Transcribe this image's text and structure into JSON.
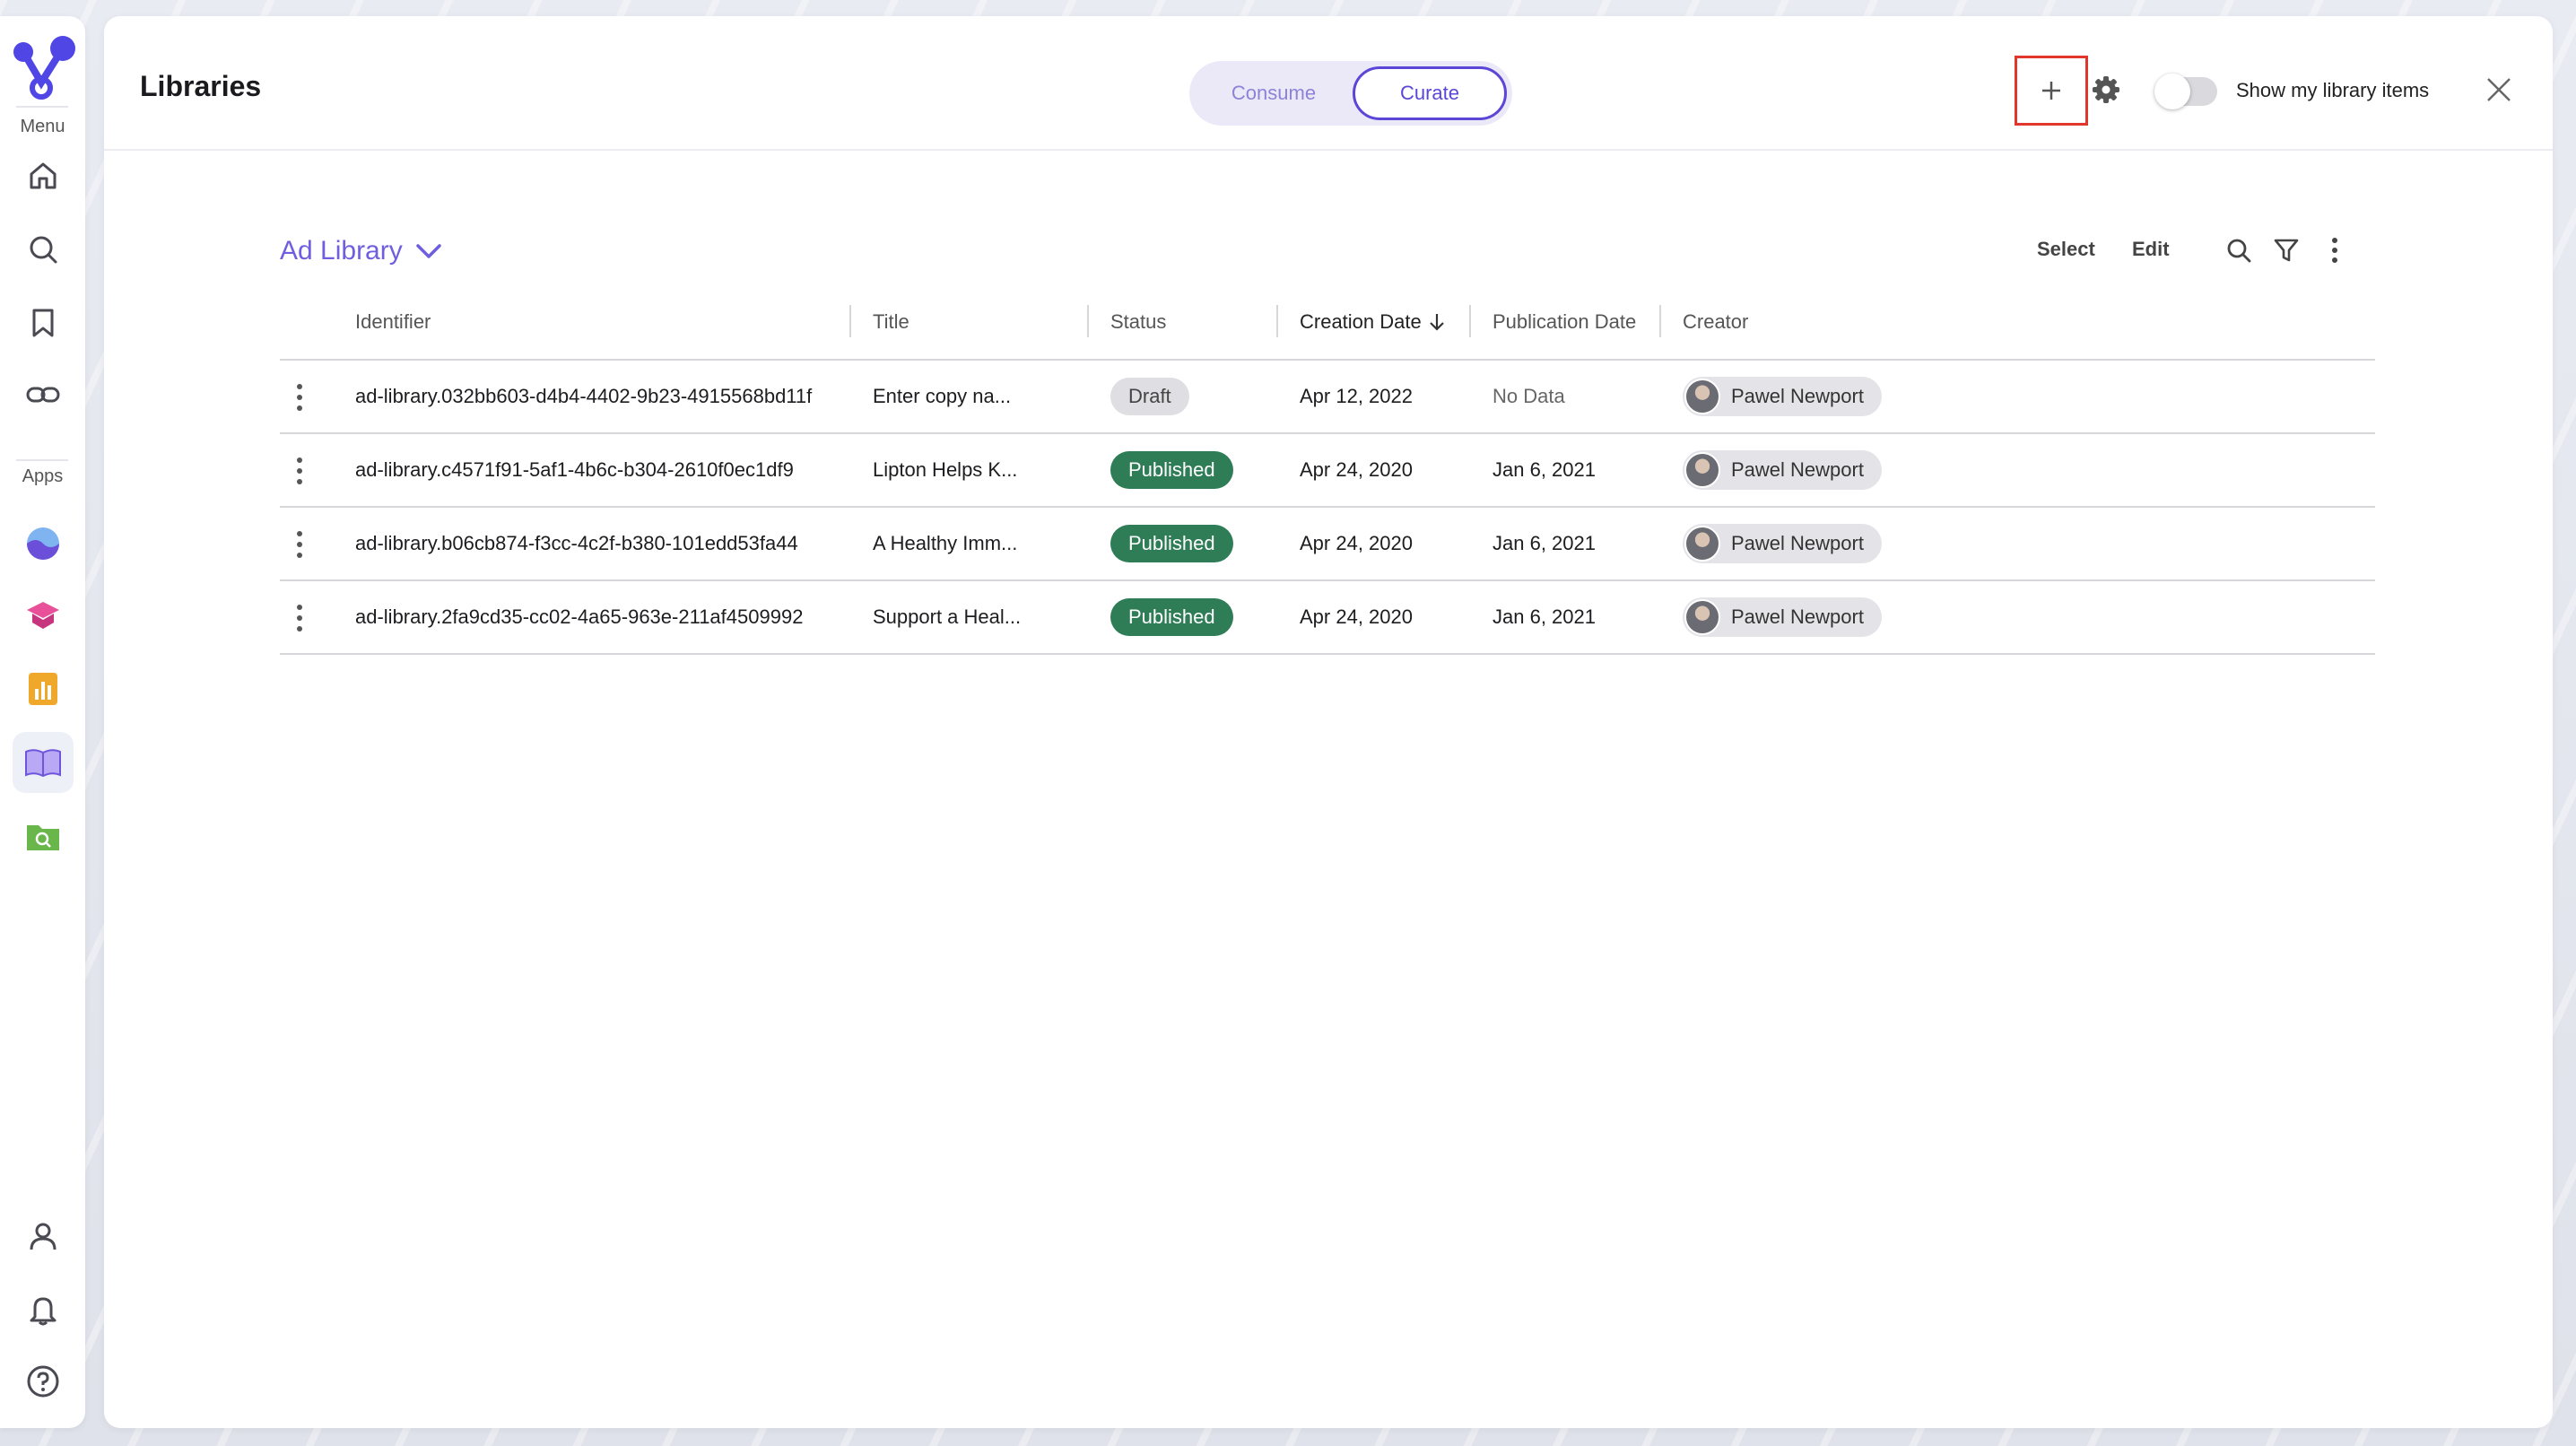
{
  "rail": {
    "menu_label": "Menu",
    "apps_label": "Apps",
    "accent": "#4f46e5"
  },
  "header": {
    "title": "Libraries",
    "tabs": [
      {
        "label": "Consume",
        "active": false
      },
      {
        "label": "Curate",
        "active": true
      }
    ],
    "toggle_label": "Show my library items",
    "toggle_on": false
  },
  "library": {
    "selected": "Ad Library",
    "toolbar": {
      "select_label": "Select",
      "edit_label": "Edit"
    }
  },
  "table": {
    "columns": [
      "Identifier",
      "Title",
      "Status",
      "Creation Date",
      "Publication Date",
      "Creator"
    ],
    "sorted_column": "Creation Date",
    "sort_direction": "desc",
    "rows": [
      {
        "identifier": "ad-library.032bb603-d4b4-4402-9b23-4915568bd11f",
        "title": "Enter copy na...",
        "status": "Draft",
        "creation_date": "Apr 12, 2022",
        "publication_date": "No Data",
        "creator": "Pawel Newport"
      },
      {
        "identifier": "ad-library.c4571f91-5af1-4b6c-b304-2610f0ec1df9",
        "title": "Lipton Helps K...",
        "status": "Published",
        "creation_date": "Apr 24, 2020",
        "publication_date": "Jan 6, 2021",
        "creator": "Pawel Newport"
      },
      {
        "identifier": "ad-library.b06cb874-f3cc-4c2f-b380-101edd53fa44",
        "title": "A Healthy Imm...",
        "status": "Published",
        "creation_date": "Apr 24, 2020",
        "publication_date": "Jan 6, 2021",
        "creator": "Pawel Newport"
      },
      {
        "identifier": "ad-library.2fa9cd35-cc02-4a65-963e-211af4509992",
        "title": "Support a Heal...",
        "status": "Published",
        "creation_date": "Apr 24, 2020",
        "publication_date": "Jan 6, 2021",
        "creator": "Pawel Newport"
      }
    ]
  },
  "colors": {
    "published": "#2e7d57",
    "draft": "#dedee3",
    "highlight_box": "#e0362b",
    "curate_accent": "#5b46d8"
  }
}
